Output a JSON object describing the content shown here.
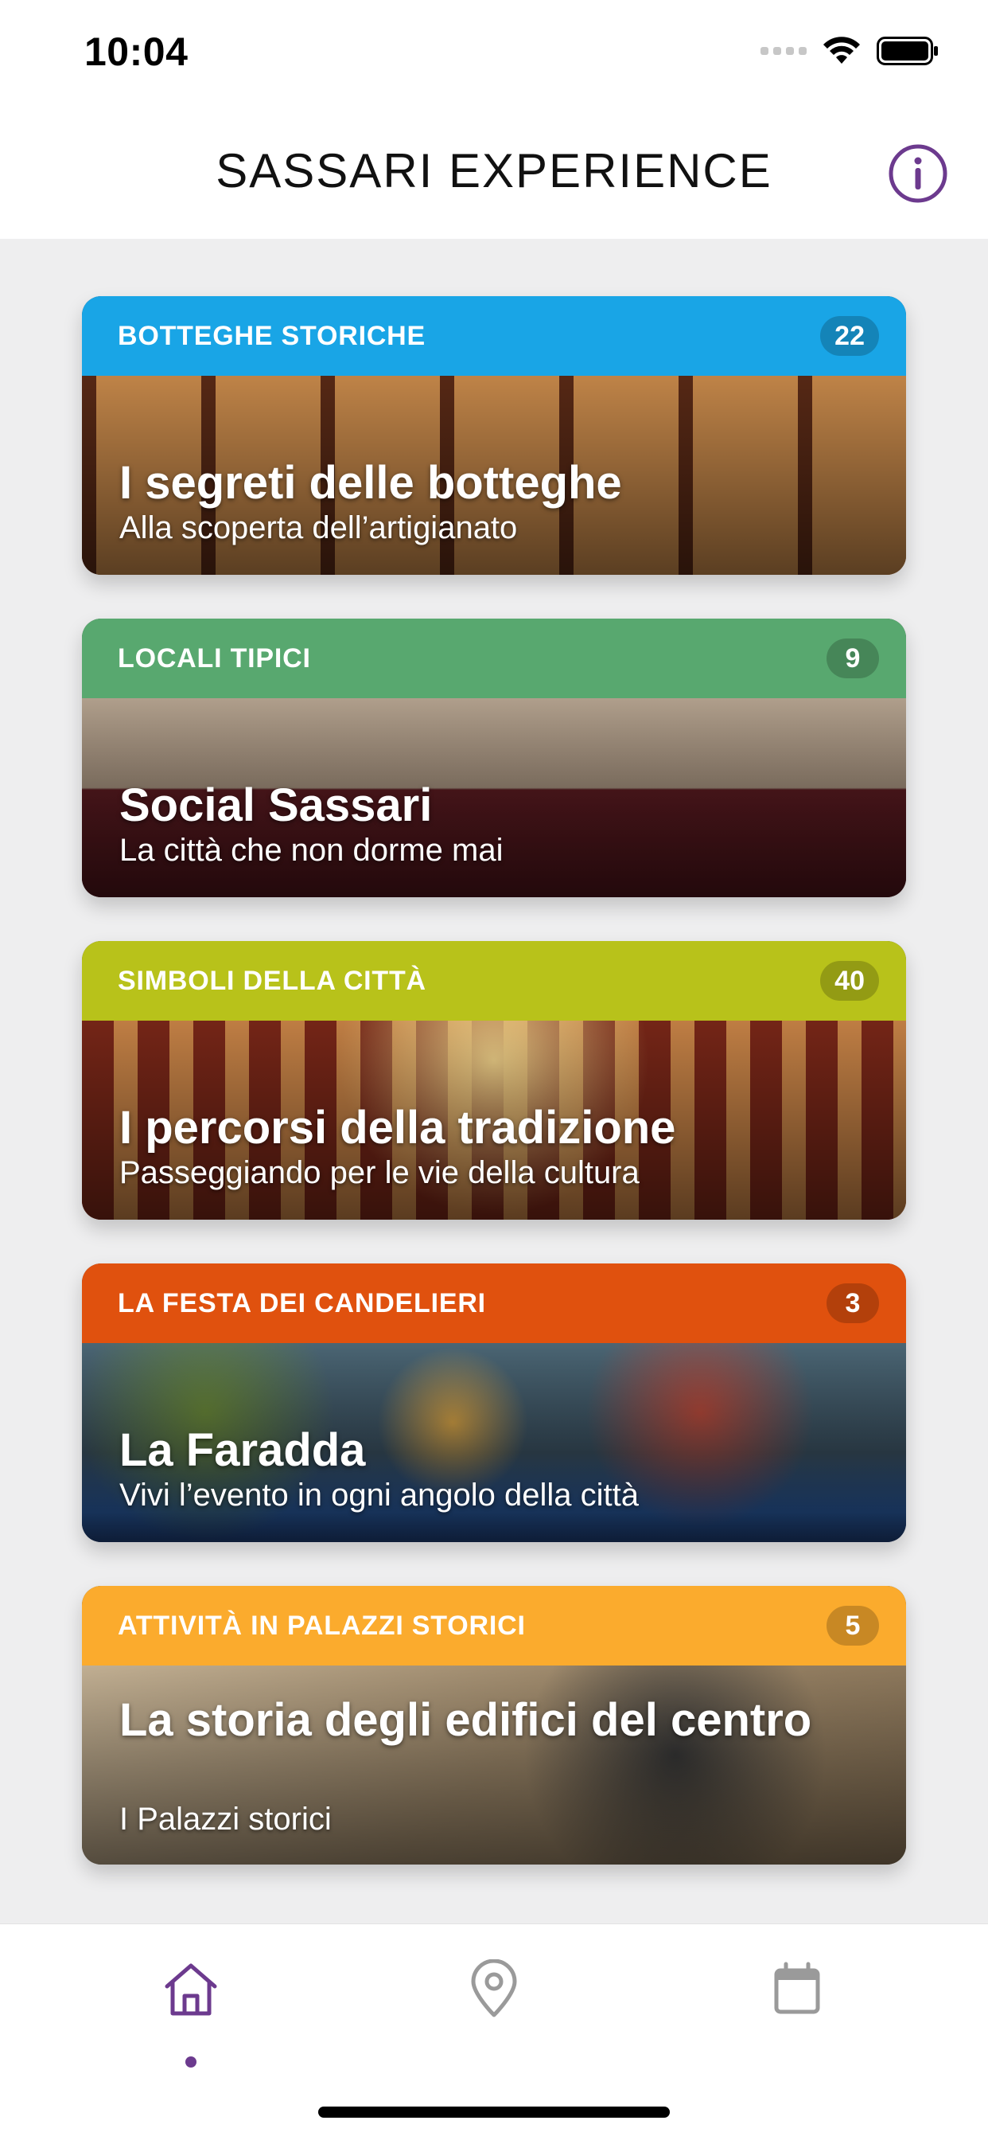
{
  "status_bar": {
    "time": "10:04"
  },
  "header": {
    "title": "SASSARI EXPERIENCE"
  },
  "colors": {
    "accent": "#6c3a8e"
  },
  "cards": [
    {
      "category": "BOTTEGHE STORICHE",
      "count": "22",
      "title": "I segreti delle botteghe",
      "subtitle": "Alla scoperta dell’artigianato",
      "band_color": "#19a5e6"
    },
    {
      "category": "LOCALI TIPICI",
      "count": "9",
      "title": "Social Sassari",
      "subtitle": "La città che non dorme mai",
      "band_color": "#58a86f"
    },
    {
      "category": "SIMBOLI DELLA CITTÀ",
      "count": "40",
      "title": "I percorsi della tradizione",
      "subtitle": "Passeggiando per le vie della cultura",
      "band_color": "#b8c21a"
    },
    {
      "category": "LA FESTA DEI CANDELIERI",
      "count": "3",
      "title": "La Faradda",
      "subtitle": "Vivi l’evento in ogni angolo della città",
      "band_color": "#e0510e"
    },
    {
      "category": "ATTIVITÀ IN PALAZZI STORICI",
      "count": "5",
      "title": "La storia degli edifici del centro",
      "subtitle": "I Palazzi storici",
      "band_color": "#fbab2d"
    }
  ],
  "tabs": [
    {
      "icon": "home-icon",
      "active": true
    },
    {
      "icon": "map-pin-icon",
      "active": false
    },
    {
      "icon": "calendar-icon",
      "active": false
    }
  ]
}
